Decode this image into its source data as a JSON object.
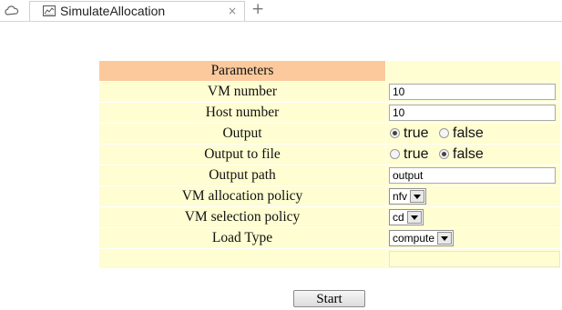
{
  "tabstrip": {
    "home_icon": "cloud-icon",
    "tab": {
      "icon": "chart-icon",
      "title": "SimulateAllocation",
      "close": "×"
    },
    "new_tab": "+"
  },
  "form": {
    "header_label": "Parameters",
    "rows": [
      {
        "label": "VM number",
        "type": "text",
        "value": "10"
      },
      {
        "label": "Host number",
        "type": "text",
        "value": "10"
      },
      {
        "label": "Output",
        "type": "radio",
        "options": [
          "true",
          "false"
        ],
        "selected": "true"
      },
      {
        "label": "Output to file",
        "type": "radio",
        "options": [
          "true",
          "false"
        ],
        "selected": "false"
      },
      {
        "label": "Output path",
        "type": "text",
        "value": "output"
      },
      {
        "label": "VM allocation policy",
        "type": "select",
        "value": "nfv"
      },
      {
        "label": "VM selection policy",
        "type": "select",
        "value": "cd"
      },
      {
        "label": "Load Type",
        "type": "select",
        "value": "compute"
      }
    ],
    "start_label": "Start"
  },
  "colors": {
    "header_bg": "#fbc99c",
    "cell_bg": "#fffdd2"
  }
}
